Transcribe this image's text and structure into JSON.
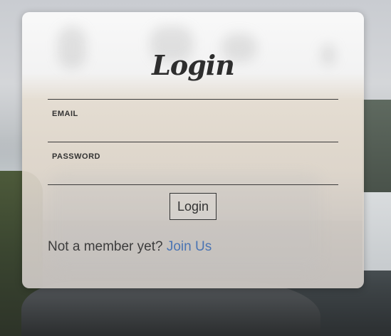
{
  "login_form": {
    "title": "Login",
    "email_label": "EMAIL",
    "email_value": "",
    "password_label": "PASSWORD",
    "password_value": "",
    "submit_label": "Login",
    "member_prompt": "Not a member yet?",
    "join_link": "Join Us"
  },
  "colors": {
    "link": "#4a74b3",
    "text": "#333333"
  }
}
